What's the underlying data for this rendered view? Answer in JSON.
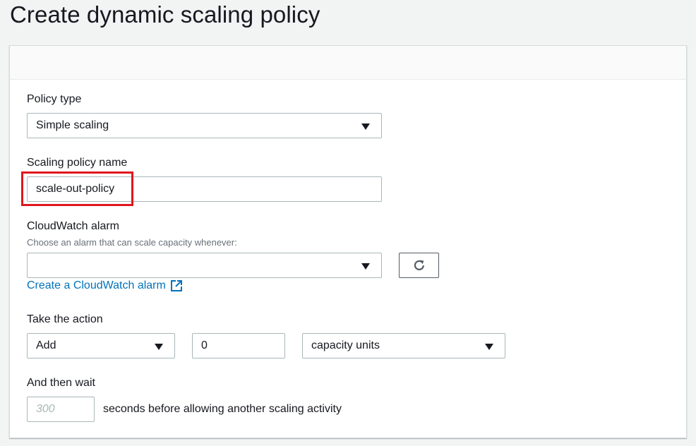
{
  "page": {
    "title": "Create dynamic scaling policy"
  },
  "form": {
    "policy_type": {
      "label": "Policy type",
      "value": "Simple scaling"
    },
    "policy_name": {
      "label": "Scaling policy name",
      "value": "scale-out-policy"
    },
    "alarm": {
      "label": "CloudWatch alarm",
      "description": "Choose an alarm that can scale capacity whenever:",
      "value": "",
      "refresh_icon": "refresh-icon",
      "create_link": "Create a CloudWatch alarm",
      "external_icon": "external-link-icon"
    },
    "action": {
      "label": "Take the action",
      "operation": "Add",
      "amount": "0",
      "unit": "capacity units"
    },
    "wait": {
      "label": "And then wait",
      "placeholder": "300",
      "suffix": "seconds before allowing another scaling activity"
    }
  },
  "colors": {
    "link": "#0073bb",
    "highlight": "#e0161d",
    "border": "#aab7b8"
  }
}
